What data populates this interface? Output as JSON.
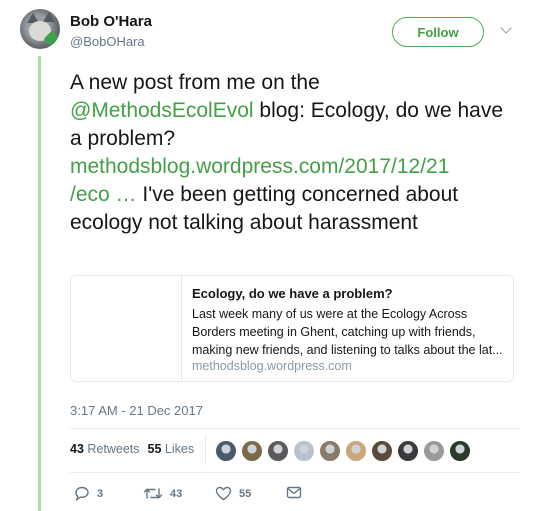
{
  "author": {
    "name": "Bob O'Hara",
    "handle": "@BobOHara"
  },
  "follow_button": {
    "label": "Follow"
  },
  "tweet": {
    "text_1": "A new post from me on the",
    "mention": "@MethodsEcolEvol",
    "text_2": " blog: Ecology, do we have a problem?",
    "link": "methodsblog.wordpress.com/2017/12/21/eco …",
    "text_3": " I've been getting concerned about ecology not talking about harassment"
  },
  "card": {
    "title": "Ecology, do we have a problem?",
    "description": "Last week many of us were at the Ecology Across Borders meeting in Ghent, catching up with friends, making new friends, and listening to talks about the lat...",
    "url": "methodsblog.wordpress.com"
  },
  "timestamp": "3:17 AM - 21 Dec 2017",
  "stats": {
    "retweet_count": "43",
    "retweet_label": "Retweets",
    "like_count": "55",
    "like_label": "Likes"
  },
  "likers": [
    "#4a5a6a",
    "#7a6a4a",
    "#5a5a5a",
    "#b8c2cc",
    "#8a7a6a",
    "#c8a878",
    "#5a4a3a",
    "#3a3a3a",
    "#9a9a9a",
    "#2a3a2a"
  ],
  "actions": {
    "reply_count": "3",
    "retweet_count": "43",
    "like_count": "55"
  },
  "colors": {
    "accent": "#43a047",
    "thread_line": "#a8e09a",
    "muted": "#657786"
  }
}
